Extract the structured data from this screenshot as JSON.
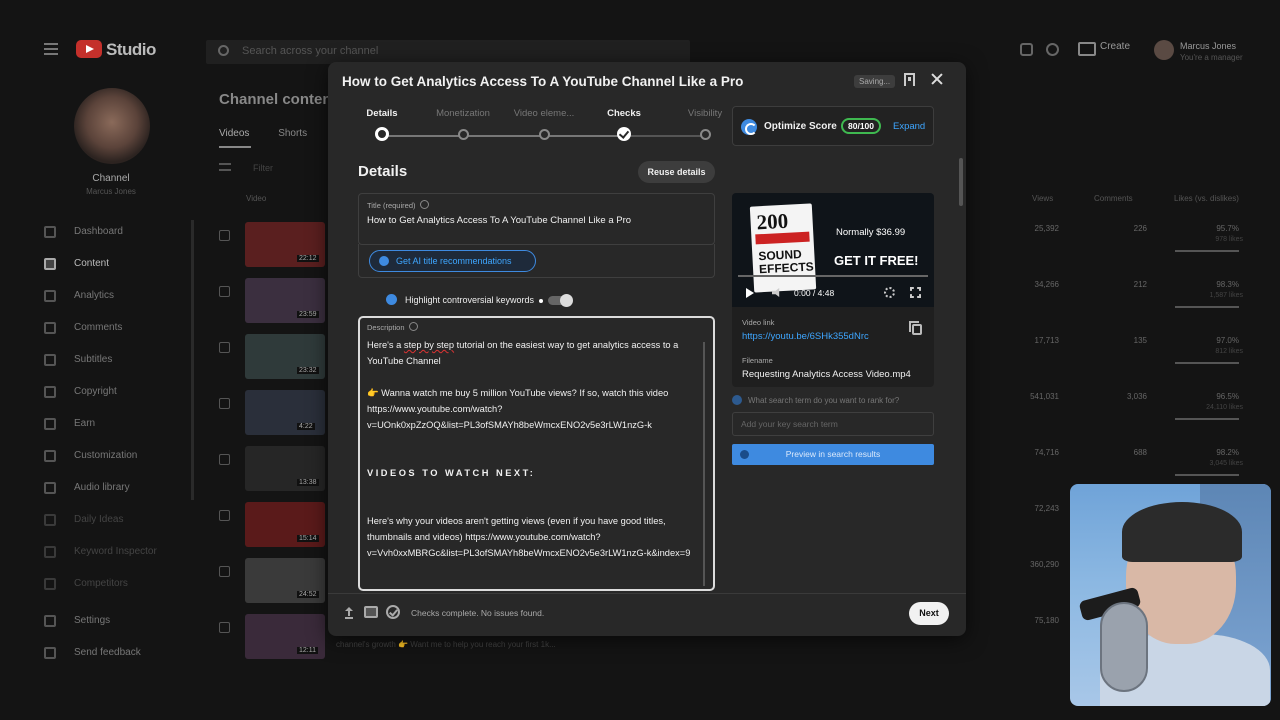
{
  "topbar": {
    "logo_text": "Studio",
    "search_placeholder": "Search across your channel",
    "create_label": "Create",
    "user_name": "Marcus Jones",
    "user_role": "You're a manager"
  },
  "sidebar": {
    "channel_title": "Channel",
    "channel_sub": "Marcus Jones",
    "items": [
      {
        "label": "Dashboard",
        "icon": "dashboard-icon"
      },
      {
        "label": "Content",
        "icon": "content-icon",
        "active": true
      },
      {
        "label": "Analytics",
        "icon": "analytics-icon"
      },
      {
        "label": "Comments",
        "icon": "comments-icon"
      },
      {
        "label": "Subtitles",
        "icon": "subtitles-icon"
      },
      {
        "label": "Copyright",
        "icon": "copyright-icon"
      },
      {
        "label": "Earn",
        "icon": "earn-icon"
      },
      {
        "label": "Customization",
        "icon": "customization-icon"
      },
      {
        "label": "Audio library",
        "icon": "audio-library-icon"
      },
      {
        "label": "Daily Ideas",
        "icon": "daily-ideas-icon"
      },
      {
        "label": "Keyword Inspector",
        "icon": "keyword-inspector-icon"
      },
      {
        "label": "Competitors",
        "icon": "competitors-icon"
      },
      {
        "label": "Settings",
        "icon": "settings-icon"
      },
      {
        "label": "Send feedback",
        "icon": "feedback-icon"
      }
    ]
  },
  "content": {
    "title": "Channel content",
    "tabs": [
      "Videos",
      "Shorts"
    ],
    "filter": "Filter",
    "columns": {
      "video": "Video",
      "views": "Views",
      "comments": "Comments",
      "likes": "Likes (vs. dislikes)"
    },
    "rows": [
      {
        "duration": "22:12",
        "views": "25,392",
        "comments": "226",
        "likes": "95.7%",
        "like_sub": "978 likes"
      },
      {
        "duration": "23:59",
        "views": "34,266",
        "comments": "212",
        "likes": "98.3%",
        "like_sub": "1,587 likes"
      },
      {
        "duration": "23:32",
        "views": "17,713",
        "comments": "135",
        "likes": "97.0%",
        "like_sub": "812 likes"
      },
      {
        "duration": "4:22",
        "views": "541,031",
        "comments": "3,036",
        "likes": "96.5%",
        "like_sub": "24,110 likes"
      },
      {
        "duration": "13:38",
        "views": "74,716",
        "comments": "688",
        "likes": "98.2%",
        "like_sub": "3,045 likes"
      },
      {
        "duration": "15:14",
        "views": "72,243",
        "comments": "",
        "likes": "",
        "like_sub": ""
      },
      {
        "duration": "24:52",
        "views": "360,290",
        "comments": "",
        "likes": "",
        "like_sub": ""
      },
      {
        "duration": "12:11",
        "views": "75,180",
        "comments": "",
        "likes": "",
        "like_sub": ""
      }
    ],
    "bottom_snippet": "channel's growth 👉 Want me to help you reach your first 1k..."
  },
  "modal": {
    "title": "How to Get Analytics Access To A YouTube Channel Like a Pro",
    "saving": "Saving...",
    "steps": [
      "Details",
      "Monetization",
      "Video eleme...",
      "Checks",
      "Visibility"
    ],
    "optimize": {
      "label": "Optimize Score",
      "score": "80/100",
      "expand": "Expand"
    },
    "details_heading": "Details",
    "reuse_label": "Reuse details",
    "title_field": {
      "label": "Title (required)",
      "value": "How to Get Analytics Access To A YouTube Channel Like a Pro"
    },
    "ai_button": "Get AI title recommendations",
    "highlight_label": "Highlight controversial keywords",
    "description_label": "Description",
    "description": {
      "p1a": "Here's a ",
      "p1_squiggle": "step by step",
      "p1b": " tutorial on the easiest way to get analytics access to a YouTube Channel",
      "p2": "👉 Wanna watch me buy 5 million YouTube views? If so, watch this video https://www.youtube.com/watch?v=UOnk0xpZzOQ&list=PL3ofSMAYh8beWmcxENO2v5e3rLW1nzG-k",
      "heading": "VIDEOS TO WATCH NEXT:",
      "p3": "Here's why your videos aren't getting views (even if you have good titles, thumbnails and videos) https://www.youtube.com/watch?v=Vvh0xxMBRGc&list=PL3ofSMAYh8beWmcxENO2v5e3rLW1nzG-k&index=9"
    },
    "preview": {
      "book_number": "200",
      "book_title": "SOUND EFFECTS",
      "promo_line1": "Normally $36.99",
      "promo_line2": "GET IT FREE!",
      "time": "0:00 / 4:48",
      "progress": 0.0
    },
    "video_link_label": "Video link",
    "video_link": "https://youtu.be/6SHk355dNrc",
    "filename_label": "Filename",
    "filename": "Requesting Analytics Access Video.mp4",
    "rank_question": "What search term do you want to rank for?",
    "keyword_placeholder": "Add your key search term",
    "preview_button": "Preview in search results",
    "status": "Checks complete. No issues found.",
    "next_label": "Next"
  }
}
